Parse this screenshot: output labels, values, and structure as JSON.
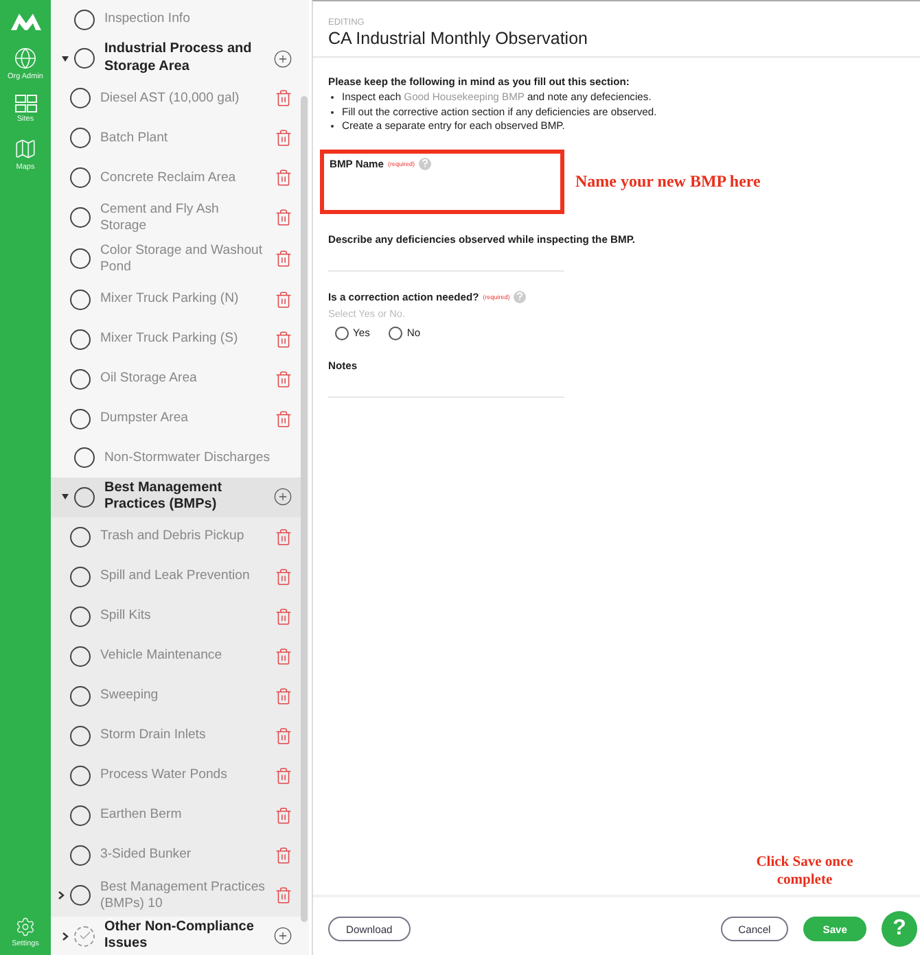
{
  "rail": {
    "items": [
      {
        "label": "Org Admin",
        "kind": "globe",
        "selected": false
      },
      {
        "label": "Sites",
        "kind": "sites",
        "selected": false
      },
      {
        "label": "Maps",
        "kind": "map",
        "selected": false
      }
    ],
    "settings": {
      "label": "Settings"
    }
  },
  "sidebar": {
    "items": [
      {
        "label": "Inspection Info",
        "completed": false
      },
      {
        "label": "Industrial Process and Storage Area",
        "completed": false,
        "expanded": true,
        "selected": false,
        "children": [
          {
            "label": "Diesel AST (10,000 gal)",
            "completed": false
          },
          {
            "label": "Batch Plant",
            "completed": false
          },
          {
            "label": "Concrete Reclaim Area",
            "completed": false
          },
          {
            "label": "Cement and Fly Ash Storage",
            "completed": false
          },
          {
            "label": "Color Storage and Washout Pond",
            "completed": false
          },
          {
            "label": "Mixer Truck Parking (N)",
            "completed": false
          },
          {
            "label": "Mixer Truck Parking (S)",
            "completed": false
          },
          {
            "label": "Oil Storage Area",
            "completed": false
          },
          {
            "label": "Dumpster Area",
            "completed": false
          }
        ]
      },
      {
        "label": "Non-Stormwater Discharges",
        "completed": false
      },
      {
        "label": "Best Management Practices (BMPs)",
        "completed": false,
        "expanded": true,
        "selected": true,
        "children": [
          {
            "label": "Trash and Debris Pickup",
            "completed": false
          },
          {
            "label": "Spill and Leak Prevention",
            "completed": false
          },
          {
            "label": "Spill Kits",
            "completed": false
          },
          {
            "label": "Vehicle Maintenance",
            "completed": false
          },
          {
            "label": "Sweeping",
            "completed": false
          },
          {
            "label": "Storm Drain Inlets",
            "completed": false
          },
          {
            "label": "Process Water Ponds",
            "completed": false
          },
          {
            "label": "Earthen Berm",
            "completed": false
          },
          {
            "label": "3-Sided Bunker",
            "completed": false
          },
          {
            "label": "Best Management Practices (BMPs) 10",
            "completed": false,
            "expanded": false
          }
        ]
      },
      {
        "label": "Other Non-Compliance Issues",
        "completed": true,
        "expanded": false,
        "selected": false
      }
    ]
  },
  "header": {
    "eyebrow": "EDITING",
    "title": "CA Industrial Monthly Observation"
  },
  "instructions": {
    "heading": "Please keep the following in mind as you fill out this section:",
    "bullets": [
      {
        "before": "Inspect each ",
        "link": "Good Housekeeping BMP",
        "after": " and note any defeciencies."
      },
      {
        "before": "Fill out the corrective action section if any deficiencies are observed."
      },
      {
        "before": "Create a separate entry for each observed BMP."
      }
    ]
  },
  "fields": [
    {
      "kind": "text",
      "label": "BMP Name",
      "required_note": "(required)",
      "help": true,
      "highlighted": true,
      "annotation": "Name your new BMP here"
    },
    {
      "kind": "text",
      "label": "Describe any deficiencies observed while inspecting the BMP."
    },
    {
      "kind": "radio",
      "label": "Is a correction action needed?",
      "required_note": "(required)",
      "help": true,
      "hint": "Select Yes or No.",
      "options": [
        {
          "label": "Yes",
          "selected": false
        },
        {
          "label": "No",
          "selected": false
        }
      ]
    },
    {
      "kind": "text",
      "label": "Notes"
    }
  ],
  "save_callout": "Click Save once complete",
  "footer": {
    "buttons": [
      {
        "label": "Download",
        "kind": "outline"
      },
      {
        "label": "Cancel",
        "kind": "outline"
      },
      {
        "label": "Save",
        "kind": "primary"
      }
    ],
    "help_button": "?"
  }
}
